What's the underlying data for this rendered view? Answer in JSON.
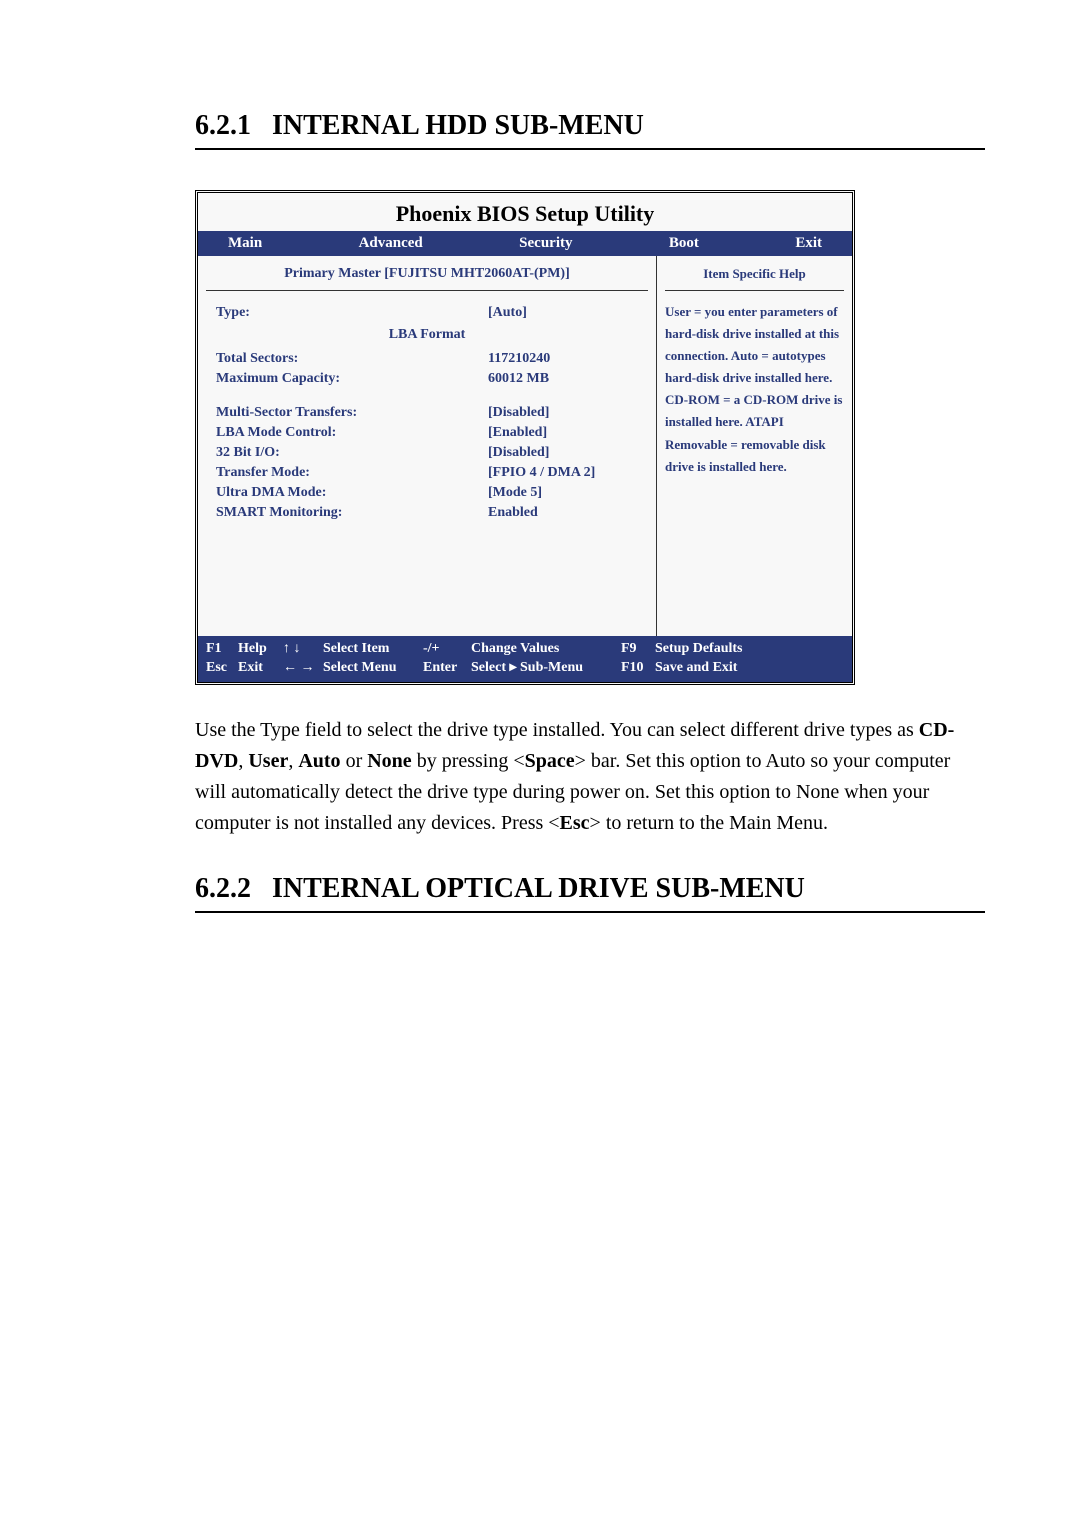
{
  "section1": {
    "number": "6.2.1",
    "title": "INTERNAL HDD SUB-MENU"
  },
  "section2": {
    "number": "6.2.2",
    "title": "INTERNAL OPTICAL DRIVE SUB-MENU"
  },
  "bios": {
    "title": "Phoenix BIOS Setup Utility",
    "menu": {
      "main": "Main",
      "advanced": "Advanced",
      "security": "Security",
      "boot": "Boot",
      "exit": "Exit"
    },
    "left_title": "Primary Master [FUJITSU MHT2060AT-(PM)]",
    "right_title": "Item Specific Help",
    "fields": {
      "type": {
        "label": "Type:",
        "value": "[Auto]"
      },
      "lba_format": {
        "label": "LBA Format"
      },
      "total_sectors": {
        "label": "Total Sectors:",
        "value": "117210240"
      },
      "max_capacity": {
        "label": "Maximum Capacity:",
        "value": "60012 MB"
      },
      "multi_sector": {
        "label": "Multi-Sector Transfers:",
        "value": "[Disabled]"
      },
      "lba_mode": {
        "label": "LBA Mode Control:",
        "value": "[Enabled]"
      },
      "bit32": {
        "label": "32 Bit I/O:",
        "value": "[Disabled]"
      },
      "transfer_mode": {
        "label": "Transfer Mode:",
        "value": "[FPIO 4 / DMA 2]"
      },
      "ultra_dma": {
        "label": "Ultra DMA Mode:",
        "value": "[Mode 5]"
      },
      "smart": {
        "label": "SMART Monitoring:",
        "value": "Enabled"
      }
    },
    "help_text": "User = you enter parameters of hard-disk drive installed at this connection. Auto = autotypes hard-disk drive installed here. CD-ROM = a CD-ROM drive is installed here. ATAPI Removable = removable disk drive is installed here.",
    "footer": {
      "f1": "F1",
      "help": "Help",
      "arrows_ud": "↑ ↓",
      "select_item": "Select Item",
      "plusminus": "-/+",
      "change_values": "Change Values",
      "f9": "F9",
      "setup_defaults": "Setup Defaults",
      "esc": "Esc",
      "exit": "Exit",
      "arrows_lr": "← →",
      "select_menu": "Select Menu",
      "enter": "Enter",
      "select_sub": "Select ▸ Sub-Menu",
      "f10": "F10",
      "save_exit": "Save and Exit"
    }
  },
  "paragraph": {
    "p1": "Use the Type field to select the drive type installed. You can select different drive types as ",
    "b1": "CD-DVD",
    "c1": ", ",
    "b2": "User",
    "c2": ", ",
    "b3": "Auto",
    "c3": " or ",
    "b4": "None",
    "c4": " by pressing <",
    "b5": "Space",
    "p2": "> bar. Set this option to Auto so your computer will automatically detect the drive type during power on. Set this option to None when your computer is not installed any devices. Press <",
    "b6": "Esc",
    "p3": "> to return to the Main Menu."
  }
}
